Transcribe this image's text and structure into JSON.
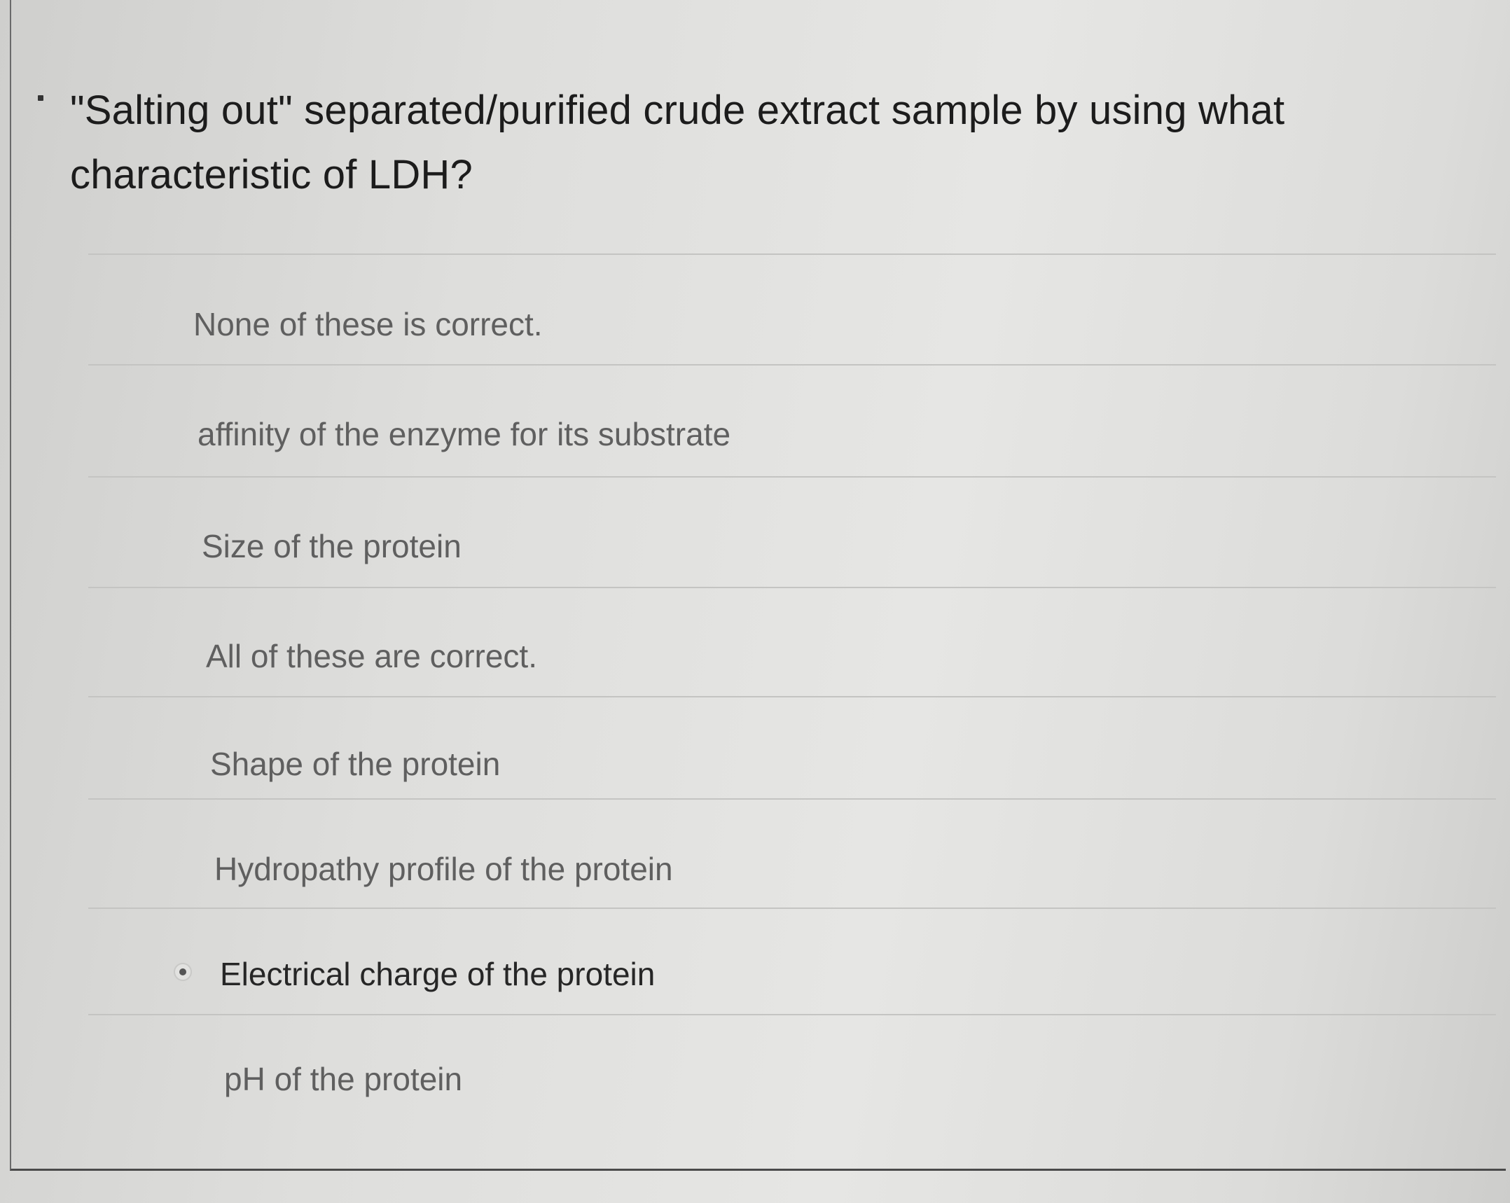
{
  "question": {
    "text": "\"Salting out\" separated/purified crude extract sample by using what characteristic of LDH?"
  },
  "options": [
    {
      "label": "None of these is correct.",
      "selected": false
    },
    {
      "label": "affinity of the enzyme for its substrate",
      "selected": false
    },
    {
      "label": "Size of the protein",
      "selected": false
    },
    {
      "label": "All of these are correct.",
      "selected": false
    },
    {
      "label": "Shape of the protein",
      "selected": false
    },
    {
      "label": "Hydropathy profile of the protein",
      "selected": false
    },
    {
      "label": "Electrical charge of the protein",
      "selected": true
    },
    {
      "label": "pH of the protein",
      "selected": false
    }
  ],
  "colors": {
    "text_primary": "#1c1c1c",
    "text_option": "#5f5f5f",
    "divider": "#c4c4c2",
    "card_border": "#4a4a4a"
  }
}
